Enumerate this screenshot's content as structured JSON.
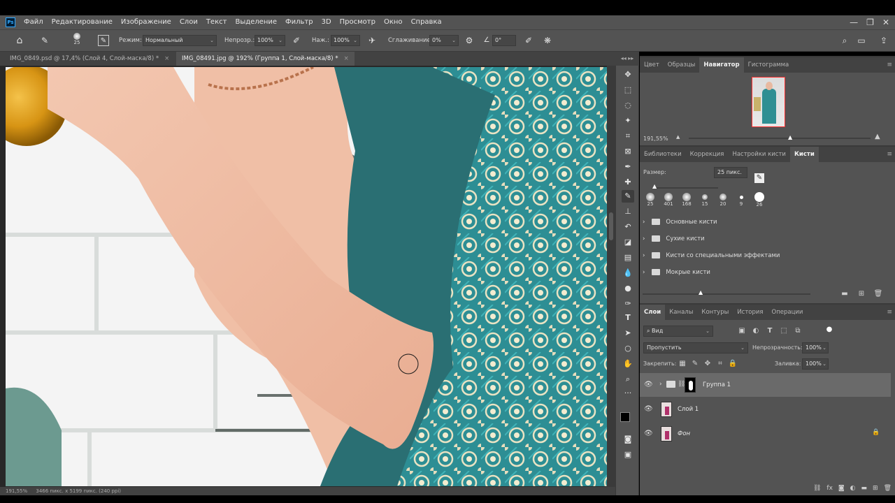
{
  "menu": {
    "logo": "Ps",
    "items": [
      "Файл",
      "Редактирование",
      "Изображение",
      "Слои",
      "Текст",
      "Выделение",
      "Фильтр",
      "3D",
      "Просмотр",
      "Окно",
      "Справка"
    ]
  },
  "options": {
    "brush_size": "25",
    "mode_label": "Режим:",
    "mode_value": "Нормальный",
    "opacity_label": "Непрозр.:",
    "opacity_value": "100%",
    "flow_label": "Наж.:",
    "flow_value": "100%",
    "smoothing_label": "Сглаживание:",
    "smoothing_value": "0%",
    "angle_value": "0°"
  },
  "tabs": [
    {
      "label": "IMG_0849.psd @ 17,4% (Слой 4, Слой-маска/8) *",
      "close": "×"
    },
    {
      "label": "IMG_08491.jpg @ 192% (Группа 1, Слой-маска/8) *",
      "close": "×"
    }
  ],
  "status": {
    "zoom": "191,55%",
    "size": "3466 пикс. x 5199 пикс. (240 ppi)"
  },
  "navigator": {
    "tabs": [
      "Цвет",
      "Образцы",
      "Навигатор",
      "Гистограмма"
    ],
    "zoom": "191,55%"
  },
  "brushes": {
    "tabs": [
      "Библиотеки",
      "Коррекция",
      "Настройки кисти",
      "Кисти"
    ],
    "size_label": "Размер:",
    "size_value": "25 пикс.",
    "presets": [
      "25",
      "401",
      "168",
      "15",
      "20",
      "9",
      "26"
    ],
    "folders": [
      "Основные кисти",
      "Сухие кисти",
      "Кисти со специальными эффектами",
      "Мокрые кисти"
    ]
  },
  "layers": {
    "tabs": [
      "Слои",
      "Каналы",
      "Контуры",
      "История",
      "Операции"
    ],
    "filter_value": "Вид",
    "blend_mode": "Пропустить",
    "opacity_label": "Непрозрачность:",
    "opacity_value": "100%",
    "lock_label": "Закрепить:",
    "fill_label": "Заливка:",
    "fill_value": "100%",
    "rows": [
      {
        "name": "Группа 1"
      },
      {
        "name": "Слой 1"
      },
      {
        "name": "Фон"
      }
    ]
  },
  "colors": {
    "ui_dark": "#535353",
    "ui_darker": "#424242",
    "accent_blue": "#31a8ff",
    "dress_teal": "#2f8f93",
    "skin": "#f0c3aa"
  }
}
